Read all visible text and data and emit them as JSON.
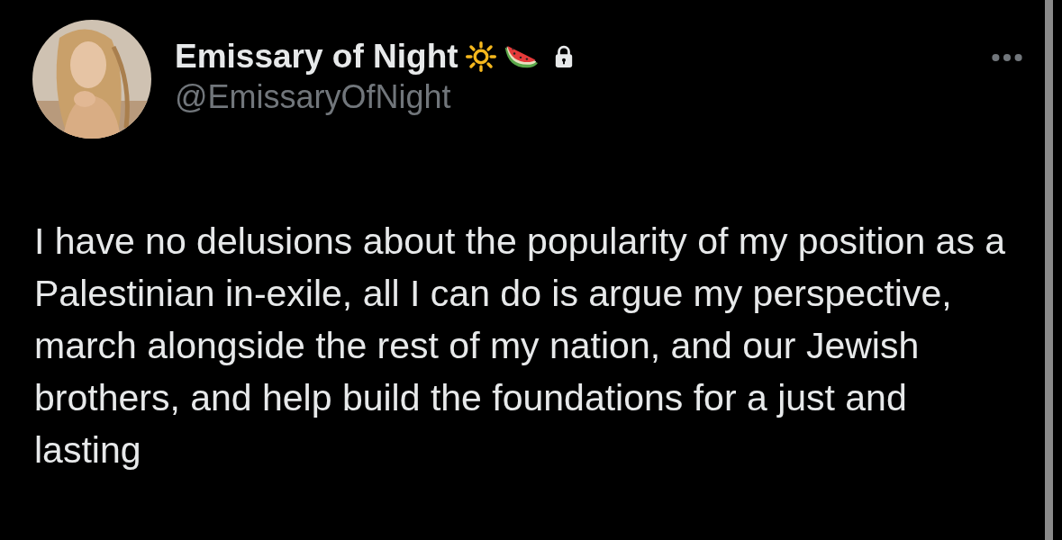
{
  "author": {
    "name": "Emissary of Night",
    "handle": "@EmissaryOfNight",
    "protected": true
  },
  "post": {
    "text": "I have no delusions about the popularity of my position as a Palestinian in-exile, all I can do is argue my perspective, march alongside the rest of my nation, and our Jewish brothers, and help build the foundations for a just and lasting"
  }
}
